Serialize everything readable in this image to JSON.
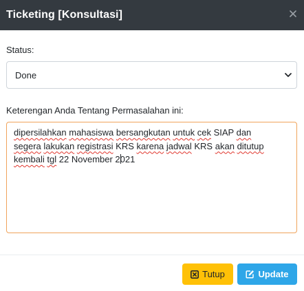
{
  "modal": {
    "title": "Ticketing [Konsultasi]",
    "close_icon": "close-icon"
  },
  "form": {
    "status_label": "Status:",
    "status_value": "Done",
    "description_label": "Keterengan Anda Tentang Permasalahan ini:",
    "description_lines": [
      [
        "dipersilahkan",
        " ",
        "mahasiswa",
        " ",
        "bersangkutan",
        " ",
        "untuk",
        " ",
        "cek",
        " SIAP ",
        "dan"
      ],
      [
        "segera",
        " ",
        "lakukan",
        " ",
        "registrasi",
        " KRS ",
        "karena",
        " ",
        "jadwal",
        " KRS ",
        "akan",
        " ",
        "ditutup"
      ],
      [
        "kembali",
        " ",
        "tgl",
        " 22 November 2021"
      ]
    ],
    "description_text": "dipersilahkan mahasiswa bersangkutan untuk cek SIAP dan segera lakukan registrasi KRS karena jadwal KRS akan ditutup kembali tgl 22 November 2021"
  },
  "footer": {
    "close_label": "Tutup",
    "close_icon": "close-square-icon",
    "update_label": "Update",
    "update_icon": "edit-icon"
  },
  "colors": {
    "header_bg": "#343a40",
    "close_button_bg": "#ffc107",
    "update_button_bg": "#2ea6e8",
    "textarea_focus_border": "#f0a35a",
    "spellcheck_underline": "#e0342b"
  }
}
